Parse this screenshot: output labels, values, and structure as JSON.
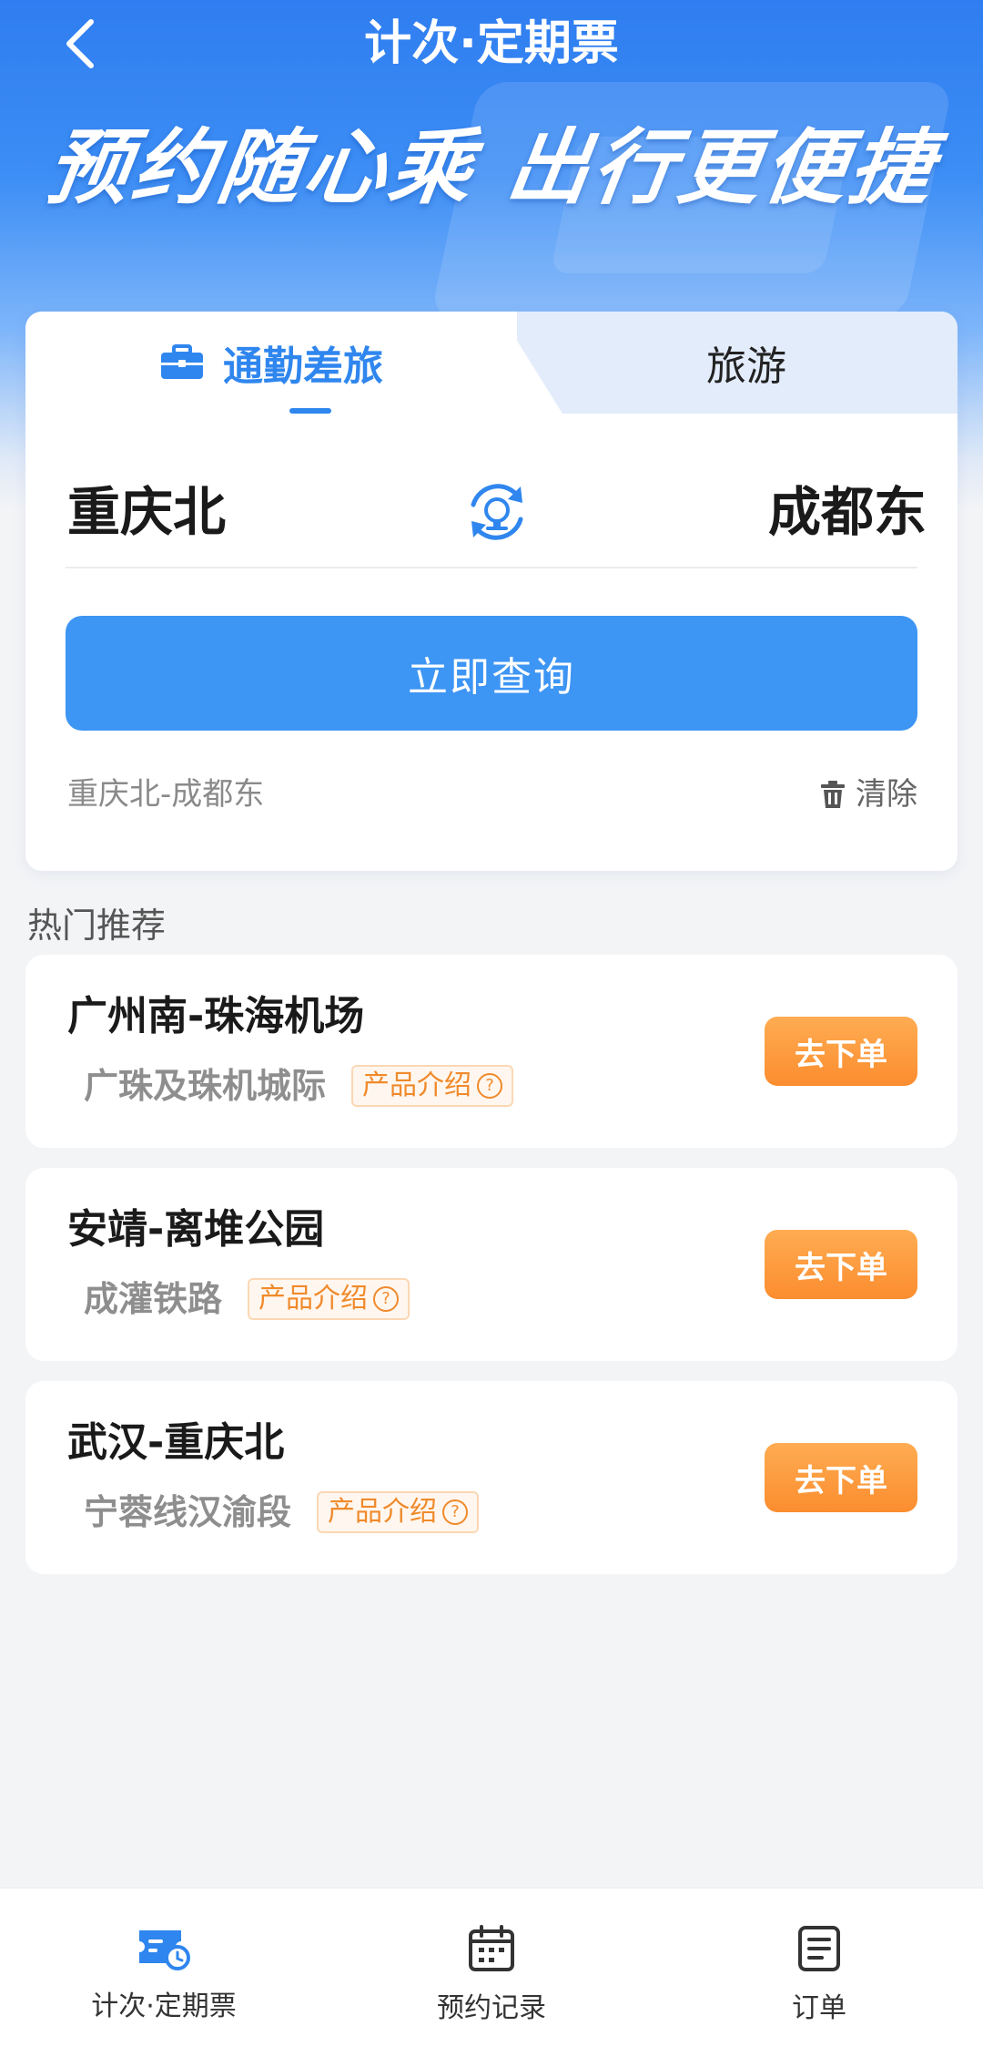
{
  "header": {
    "title": "计次·定期票",
    "slogan": "预约随心乘 出行更便捷"
  },
  "query": {
    "tabs": [
      {
        "label": "通勤差旅",
        "active": true
      },
      {
        "label": "旅游",
        "active": false
      }
    ],
    "from_station": "重庆北",
    "to_station": "成都东",
    "search_label": "立即查询",
    "history": "重庆北-成都东",
    "clear_label": "清除"
  },
  "recommend": {
    "title": "热门推荐",
    "items": [
      {
        "route": "广州南-珠海机场",
        "line": "广珠及珠机城际",
        "tag": "产品介绍",
        "action": "去下单"
      },
      {
        "route": "安靖-离堆公园",
        "line": "成灌铁路",
        "tag": "产品介绍",
        "action": "去下单"
      },
      {
        "route": "武汉-重庆北",
        "line": "宁蓉线汉渝段",
        "tag": "产品介绍",
        "action": "去下单"
      }
    ]
  },
  "bottom_nav": [
    {
      "label": "计次·定期票",
      "icon": "ticket-clock-icon",
      "active": true
    },
    {
      "label": "预约记录",
      "icon": "calendar-icon",
      "active": false
    },
    {
      "label": "订单",
      "icon": "order-list-icon",
      "active": false
    }
  ],
  "colors": {
    "primary": "#3d95f4",
    "accent_orange": "#fb8d2f",
    "tab_active": "#2f86ee"
  }
}
